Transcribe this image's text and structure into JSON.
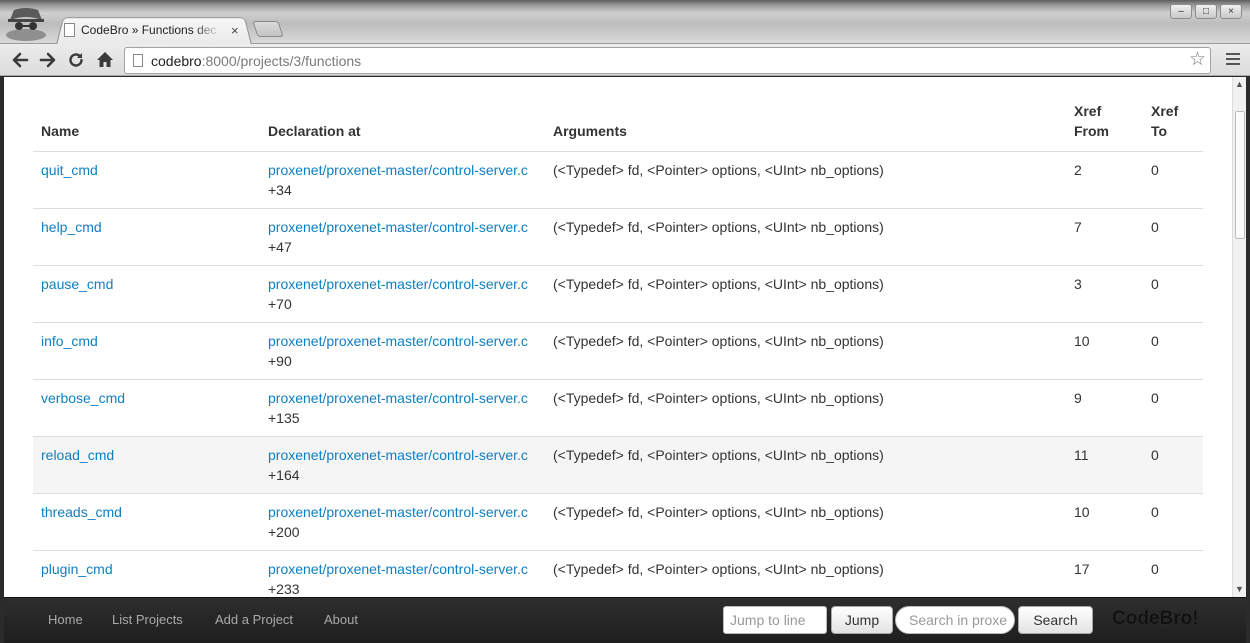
{
  "browser": {
    "tab_title": "CodeBro » Functions dec",
    "tab_close": "×",
    "url_host": "codebro",
    "url_rest": ":8000/projects/3/functions",
    "window_minimize": "–",
    "window_maximize": "□",
    "window_close": "×"
  },
  "table": {
    "headers": {
      "name": "Name",
      "declaration": "Declaration at",
      "arguments": "Arguments",
      "xref_from_1": "Xref",
      "xref_from_2": "From",
      "xref_to_1": "Xref",
      "xref_to_2": "To"
    },
    "rows": [
      {
        "name": "quit_cmd",
        "file": "proxenet/proxenet-master/control-server.c",
        "line": "+34",
        "args": "(<Typedef> fd, <Pointer> options, <UInt> nb_options)",
        "xref_from": "2",
        "xref_to": "0"
      },
      {
        "name": "help_cmd",
        "file": "proxenet/proxenet-master/control-server.c",
        "line": "+47",
        "args": "(<Typedef> fd, <Pointer> options, <UInt> nb_options)",
        "xref_from": "7",
        "xref_to": "0"
      },
      {
        "name": "pause_cmd",
        "file": "proxenet/proxenet-master/control-server.c",
        "line": "+70",
        "args": "(<Typedef> fd, <Pointer> options, <UInt> nb_options)",
        "xref_from": "3",
        "xref_to": "0"
      },
      {
        "name": "info_cmd",
        "file": "proxenet/proxenet-master/control-server.c",
        "line": "+90",
        "args": "(<Typedef> fd, <Pointer> options, <UInt> nb_options)",
        "xref_from": "10",
        "xref_to": "0"
      },
      {
        "name": "verbose_cmd",
        "file": "proxenet/proxenet-master/control-server.c",
        "line": "+135",
        "args": "(<Typedef> fd, <Pointer> options, <UInt> nb_options)",
        "xref_from": "9",
        "xref_to": "0"
      },
      {
        "name": "reload_cmd",
        "file": "proxenet/proxenet-master/control-server.c",
        "line": "+164",
        "args": "(<Typedef> fd, <Pointer> options, <UInt> nb_options)",
        "xref_from": "11",
        "xref_to": "0"
      },
      {
        "name": "threads_cmd",
        "file": "proxenet/proxenet-master/control-server.c",
        "line": "+200",
        "args": "(<Typedef> fd, <Pointer> options, <UInt> nb_options)",
        "xref_from": "10",
        "xref_to": "0"
      },
      {
        "name": "plugin_cmd",
        "file": "proxenet/proxenet-master/control-server.c",
        "line": "+233",
        "args": "(<Typedef> fd, <Pointer> options, <UInt> nb_options)",
        "xref_from": "17",
        "xref_to": "0"
      }
    ]
  },
  "navbar": {
    "home": "Home",
    "list_projects": "List Projects",
    "add_project": "Add a Project",
    "about": "About",
    "jump_placeholder": "Jump to line",
    "jump_button": "Jump",
    "search_placeholder": "Search in proxenet",
    "search_button": "Search",
    "brand": "CodeBro!"
  }
}
